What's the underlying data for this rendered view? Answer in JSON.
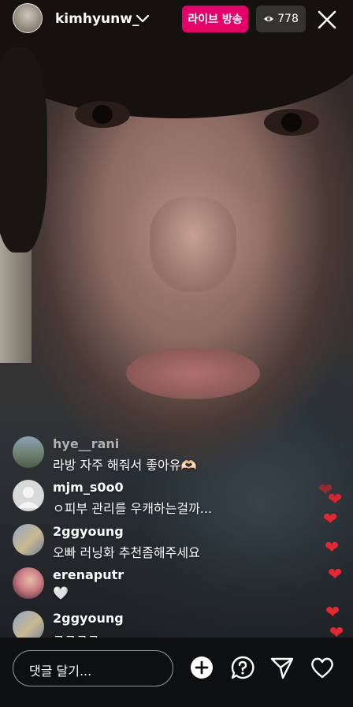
{
  "header": {
    "username": "kimhyunw_",
    "live_button_label": "라이브 방송",
    "viewer_count": "778"
  },
  "comments": [
    {
      "user": "hye__rani",
      "text": "라방 자주 해줘서 좋아유🫶🏻"
    },
    {
      "user": "mjm_s0o0",
      "text": "ㅇ피부 관리를 우캐하는걸까..."
    },
    {
      "user": "2ggyoung",
      "text": "오빠 러닝화 추천좀해주세요"
    },
    {
      "user": "erenaputr",
      "text": "🤍"
    },
    {
      "user": "2ggyoung",
      "text": "ㅋㅋㅋㅋ"
    }
  ],
  "composer": {
    "placeholder": "댓글 달기..."
  },
  "colors": {
    "live_pink": "#e6006a",
    "heart_red": "#e8262e",
    "bottom_bar": "#0e0f10"
  },
  "icons": [
    "chevron-down-icon",
    "eye-icon",
    "close-icon",
    "add-icon",
    "question-icon",
    "send-icon",
    "heart-icon"
  ]
}
